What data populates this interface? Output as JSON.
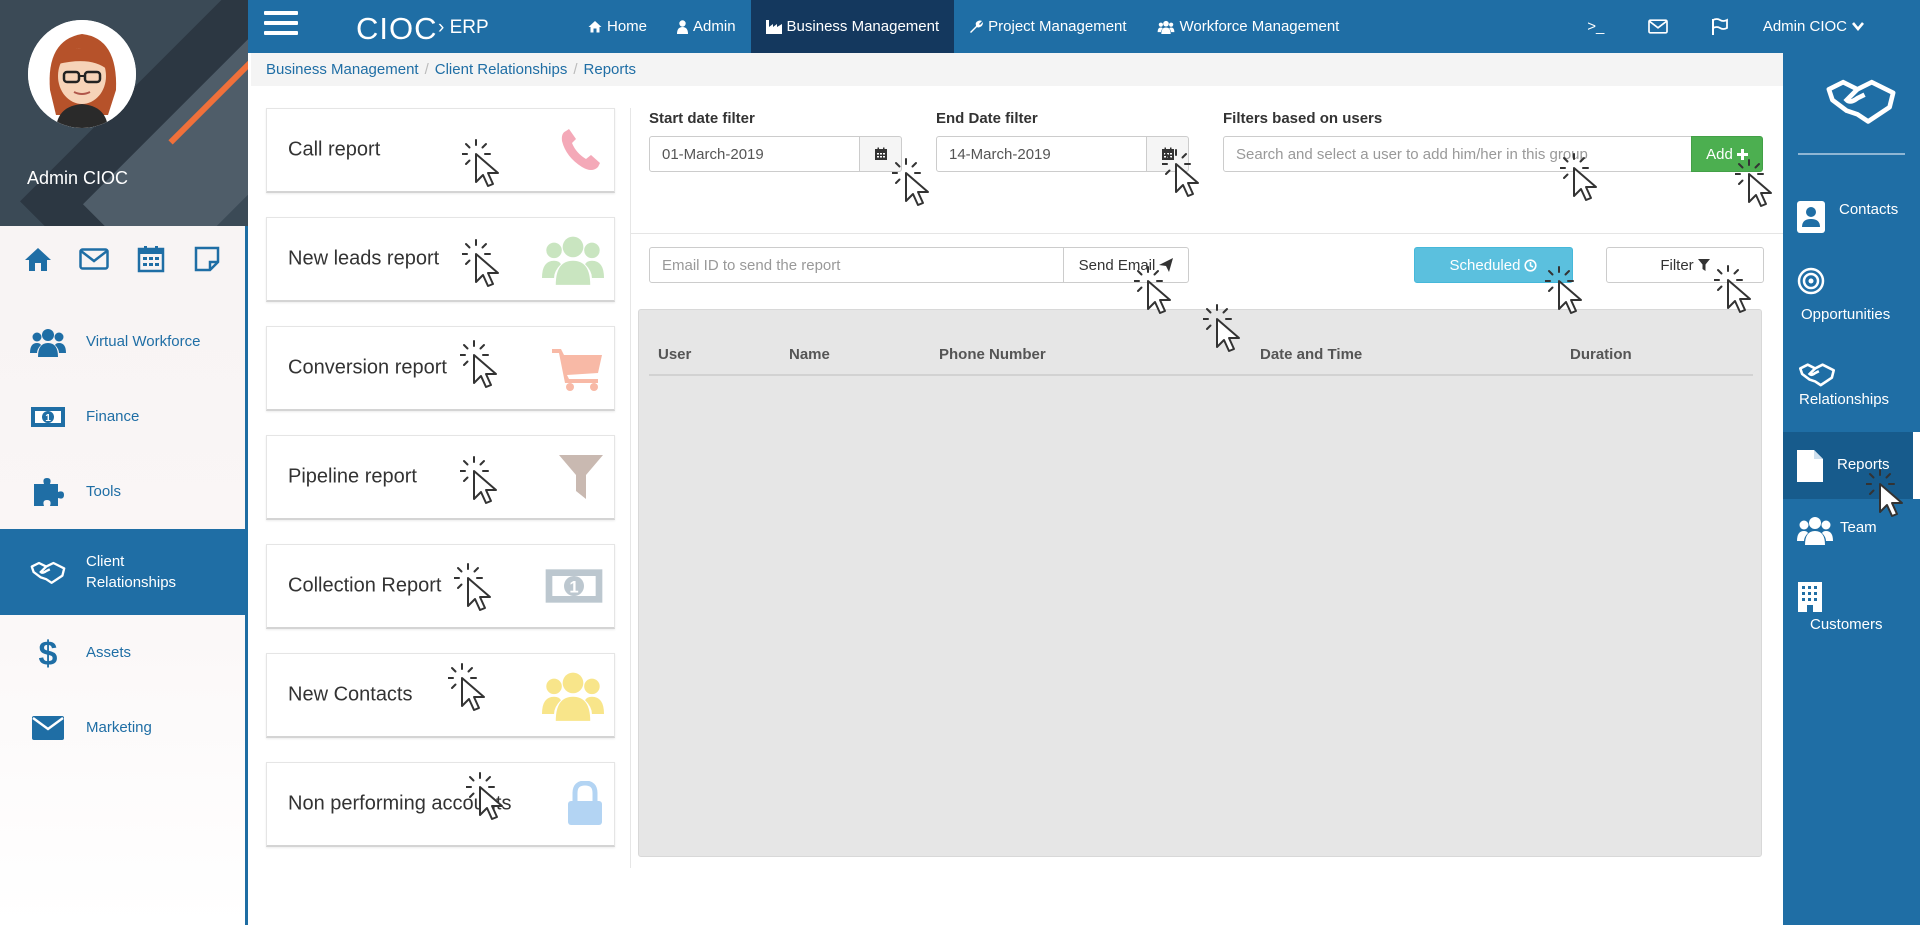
{
  "profile": {
    "name": "Admin CIOC"
  },
  "quick_icons": [
    "home-icon",
    "envelope-icon",
    "calendar-icon",
    "note-icon"
  ],
  "left_nav": [
    {
      "label": "Virtual Workforce",
      "icon": "users-icon"
    },
    {
      "label": "Finance",
      "icon": "money-icon"
    },
    {
      "label": "Tools",
      "icon": "puzzle-icon"
    },
    {
      "label": "Client Relationships",
      "icon": "handshake-icon",
      "active": true
    },
    {
      "label": "Assets",
      "icon": "dollar-icon"
    },
    {
      "label": "Marketing",
      "icon": "envelope-icon"
    }
  ],
  "topbar": {
    "brand": "CIOC",
    "brand_sub": "› ERP",
    "menu": [
      {
        "label": "Home",
        "icon": "home-icon"
      },
      {
        "label": "Admin",
        "icon": "user-icon"
      },
      {
        "label": "Business Management",
        "icon": "industry-icon",
        "active": true
      },
      {
        "label": "Project Management",
        "icon": "wrench-icon"
      },
      {
        "label": "Workforce Management",
        "icon": "users-icon"
      }
    ],
    "terminal": ">_",
    "user_menu": "Admin CIOC"
  },
  "breadcrumb": [
    "Business Management",
    "Client Relationships",
    "Reports"
  ],
  "reports": [
    {
      "label": "Call report",
      "icon": "phone-icon",
      "color": "#f4a9b8"
    },
    {
      "label": "New leads report",
      "icon": "users-icon",
      "color": "#c9e5c0"
    },
    {
      "label": "Conversion report",
      "icon": "cart-icon",
      "color": "#f8b9a6"
    },
    {
      "label": "Pipeline report",
      "icon": "funnel-icon",
      "color": "#c9b9b1"
    },
    {
      "label": "Collection Report",
      "icon": "money-icon",
      "color": "#bcc7cf"
    },
    {
      "label": "New Contacts",
      "icon": "users-icon",
      "color": "#f8e58a"
    },
    {
      "label": "Non performing accounts",
      "icon": "lock-icon",
      "color": "#b3d4f3"
    }
  ],
  "filters": {
    "start_label": "Start date filter",
    "start_value": "01-March-2019",
    "end_label": "End Date filter",
    "end_value": "14-March-2019",
    "users_label": "Filters based on users",
    "users_placeholder": "Search and select a user to add him/her in this group",
    "add_label": "Add",
    "email_placeholder": "Email ID to send the report",
    "send_email_label": "Send Email",
    "scheduled_label": "Scheduled",
    "filter_label": "Filter"
  },
  "table": {
    "columns": [
      "User",
      "Name",
      "Phone Number",
      "Date and Time",
      "Duration"
    ],
    "rows": []
  },
  "right_nav": [
    {
      "label": "Contacts",
      "icon": "contact-icon"
    },
    {
      "label": "Opportunities",
      "icon": "target-icon"
    },
    {
      "label": "Relationships",
      "icon": "handshake-icon"
    },
    {
      "label": "Reports",
      "icon": "file-icon",
      "active": true
    },
    {
      "label": "Team",
      "icon": "users-icon"
    },
    {
      "label": "Customers",
      "icon": "building-icon"
    }
  ],
  "colors": {
    "primary": "#1f6ea5",
    "active_top": "#14385e",
    "success": "#4caf50",
    "info": "#5bc0de"
  }
}
